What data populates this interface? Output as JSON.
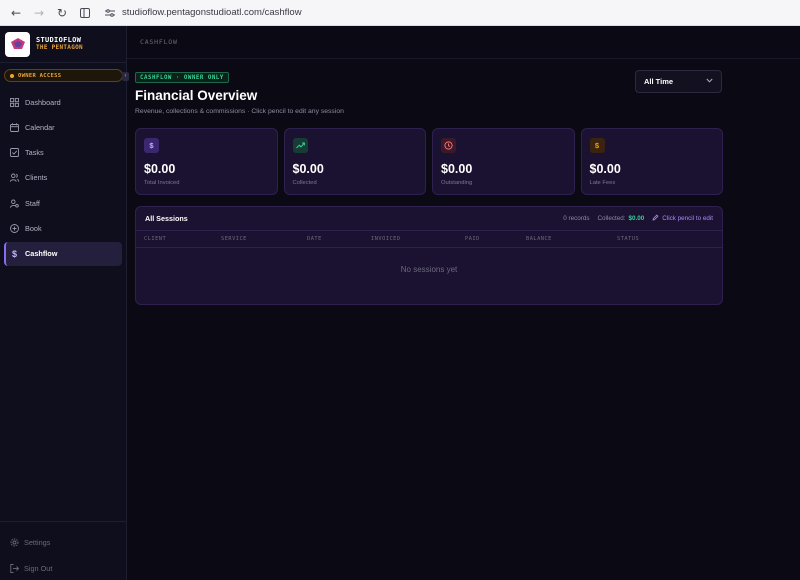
{
  "browser": {
    "url": "studioflow.pentagonstudioatl.com/cashflow"
  },
  "brand": {
    "name": "STUDIOFLOW",
    "subtitle": "THE PENTAGON"
  },
  "owner_badge": "OWNER ACCESS",
  "sidebar": {
    "items": [
      {
        "label": "Dashboard",
        "icon": "dashboard-icon"
      },
      {
        "label": "Calendar",
        "icon": "calendar-icon"
      },
      {
        "label": "Tasks",
        "icon": "tasks-icon"
      },
      {
        "label": "Clients",
        "icon": "clients-icon"
      },
      {
        "label": "Staff",
        "icon": "staff-icon"
      },
      {
        "label": "Book",
        "icon": "book-icon"
      },
      {
        "label": "Cashflow",
        "icon": "dollar-icon",
        "active": true
      }
    ],
    "footer": [
      {
        "label": "Settings",
        "icon": "gear-icon"
      },
      {
        "label": "Sign Out",
        "icon": "sign-out-icon"
      }
    ]
  },
  "topbar": {
    "breadcrumb": "CASHFLOW"
  },
  "header": {
    "tag": "CASHFLOW · OWNER ONLY",
    "title": "Financial Overview",
    "subtitle": "Revenue, collections & commissions · Click pencil to edit any session",
    "range": "All Time"
  },
  "cards": [
    {
      "value": "$0.00",
      "label": "Total Invoiced",
      "icon": "dollar-icon",
      "color": "#a78bfa"
    },
    {
      "value": "$0.00",
      "label": "Collected",
      "icon": "trending-up-icon",
      "color": "#34d399"
    },
    {
      "value": "$0.00",
      "label": "Outstanding",
      "icon": "clock-icon",
      "color": "#f87171"
    },
    {
      "value": "$0.00",
      "label": "Late Fees",
      "icon": "dollar-icon",
      "color": "#f59e0b"
    }
  ],
  "sessions": {
    "title": "All Sessions",
    "records": "0 records",
    "collected_label": "Collected:",
    "collected_value": "$0.00",
    "edit_hint": "Click pencil to edit",
    "columns": [
      "CLIENT",
      "SERVICE",
      "DATE",
      "INVOICED",
      "PAID",
      "BALANCE",
      "STATUS"
    ],
    "empty": "No sessions yet"
  }
}
